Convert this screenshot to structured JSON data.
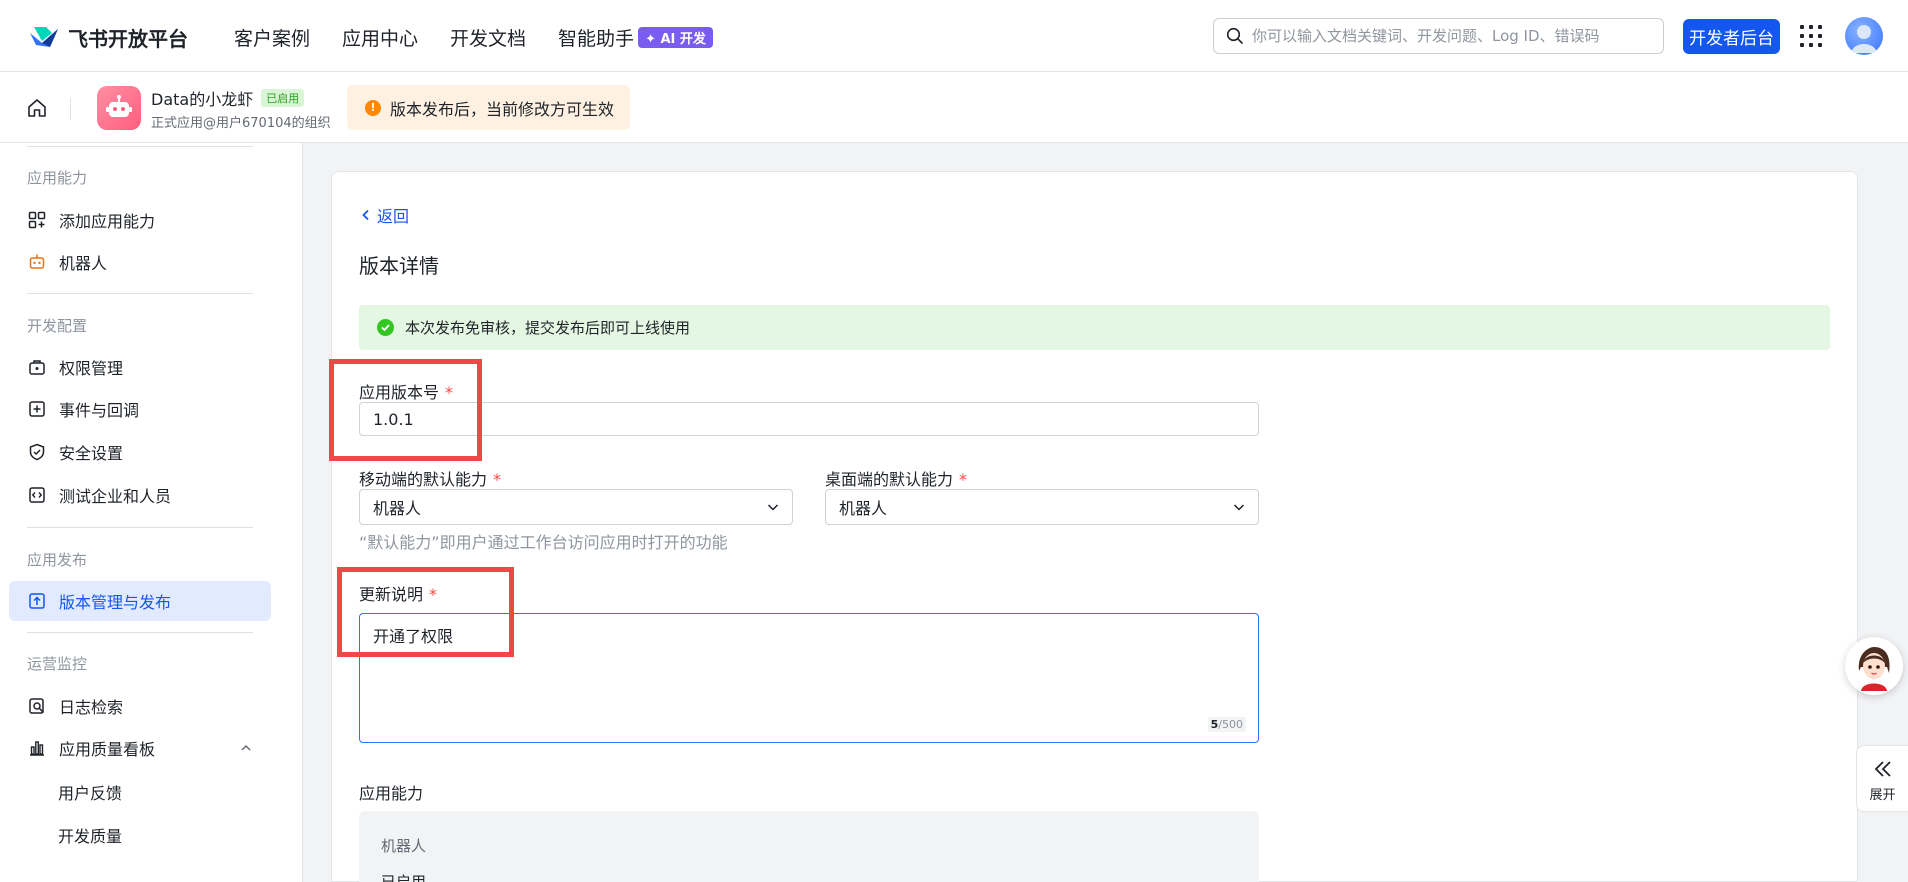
{
  "topnav": {
    "brand": "飞书开放平台",
    "links": [
      "客户案例",
      "应用中心",
      "开发文档",
      "智能助手"
    ],
    "ai_badge": "✦ AI 开发",
    "search_placeholder": "你可以输入文档关键词、开发问题、Log ID、错误码",
    "dev_console": "开发者后台"
  },
  "appbar": {
    "app_name": "Data的小龙虾",
    "status_tag": "已启用",
    "app_desc": "正式应用@用户670104的组织",
    "notice": "版本发布后，当前修改方可生效"
  },
  "sidebar": {
    "group_capability": "应用能力",
    "add_capability": "添加应用能力",
    "bot": "机器人",
    "group_dev": "开发配置",
    "permissions": "权限管理",
    "events": "事件与回调",
    "security": "安全设置",
    "test_org": "测试企业和人员",
    "group_release": "应用发布",
    "version_release": "版本管理与发布",
    "group_ops": "运营监控",
    "log_search": "日志检索",
    "quality_board": "应用质量看板",
    "user_feedback": "用户反馈",
    "dev_quality": "开发质量"
  },
  "main": {
    "back": "返回",
    "title": "版本详情",
    "success_msg": "本次发布免审核，提交发布后即可上线使用",
    "version_label": "应用版本号",
    "required_mark": "*",
    "version_value": "1.0.1",
    "mobile_label": "移动端的默认能力",
    "mobile_value": "机器人",
    "desktop_label": "桌面端的默认能力",
    "desktop_value": "机器人",
    "hint": "“默认能力”即用户通过工作台访问应用时打开的功能",
    "notes_label": "更新说明",
    "notes_value": "开通了权限",
    "notes_count": "5",
    "notes_max": "/500",
    "capability_section": "应用能力",
    "capability_name": "机器人",
    "capability_state": "已启用"
  },
  "floating": {
    "expand_label": "展开"
  },
  "colors": {
    "primary": "#1456f0",
    "success": "#34c724",
    "warning": "#ff8800",
    "highlight": "#f04848"
  }
}
